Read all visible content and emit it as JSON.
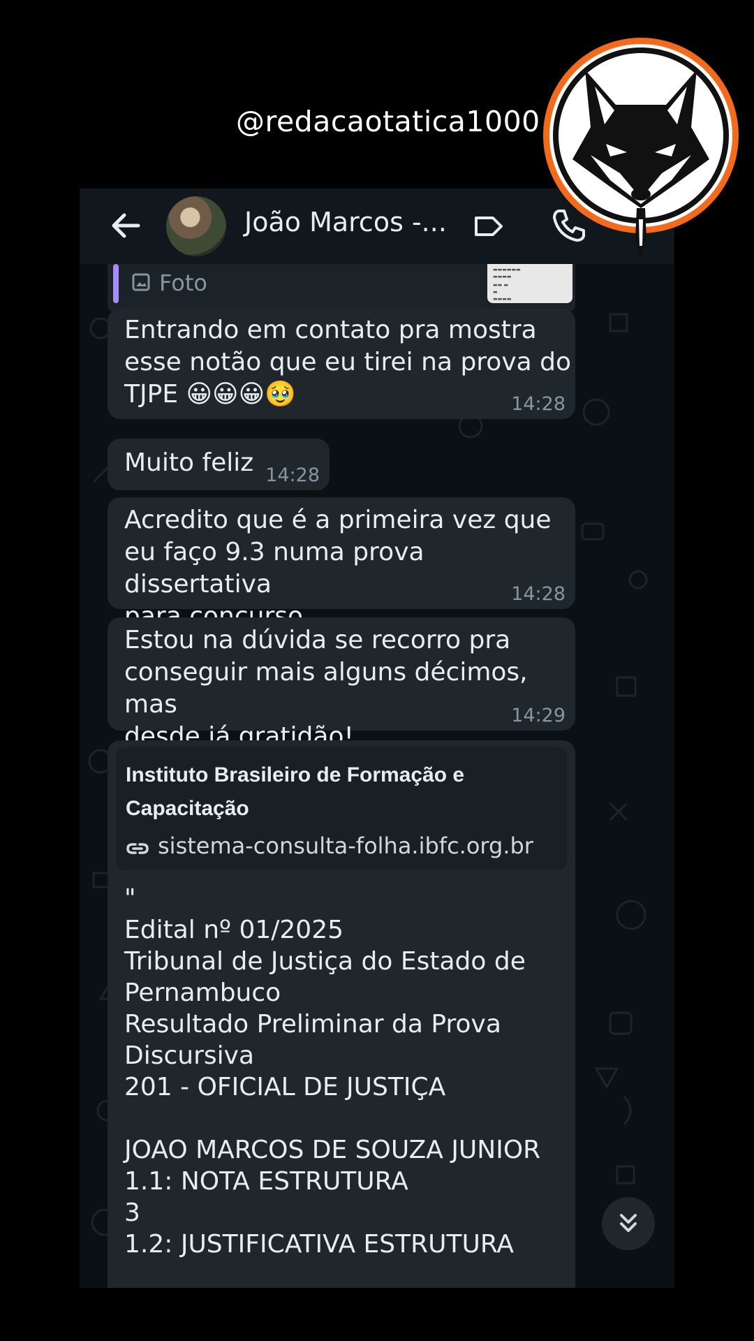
{
  "watermark": {
    "handle": "@redacaotatica1000"
  },
  "header": {
    "contact_name": "João Marcos -..."
  },
  "quoted": {
    "label": "Foto"
  },
  "messages": [
    {
      "text": "Entrando em contato pra mostra\nesse notão que eu tirei na prova do\nTJPE 😀😀😀🥹",
      "time": "14:28"
    },
    {
      "text": "Muito feliz",
      "time": "14:28"
    },
    {
      "text": "Acredito que é a primeira vez que\neu faço 9.3 numa prova dissertativa\npara concurso",
      "time": "14:28"
    },
    {
      "text": "Estou na dúvida se recorro pra\nconseguir mais alguns décimos, mas\ndesde já gratidão!",
      "time": "14:29"
    }
  ],
  "link_message": {
    "preview_title": "Instituto Brasileiro de Formação e Capacitação",
    "preview_url": "sistema-consulta-folha.ibfc.org.br",
    "body": "\"\nEdital nº 01/2025\nTribunal de Justiça do Estado de\nPernambuco\nResultado Preliminar da Prova\nDiscursiva\n201 - OFICIAL DE JUSTIÇA\n\nJOAO MARCOS DE SOUZA JUNIOR\n1.1: NOTA ESTRUTURA\n3\n1.2: JUSTIFICATIVA ESTRUTURA"
  },
  "colors": {
    "bubble": "#1f272d",
    "header": "#11181d",
    "background": "#0b1014",
    "quote_accent": "#a78bfa",
    "logo_ring": "#f26a1b"
  }
}
